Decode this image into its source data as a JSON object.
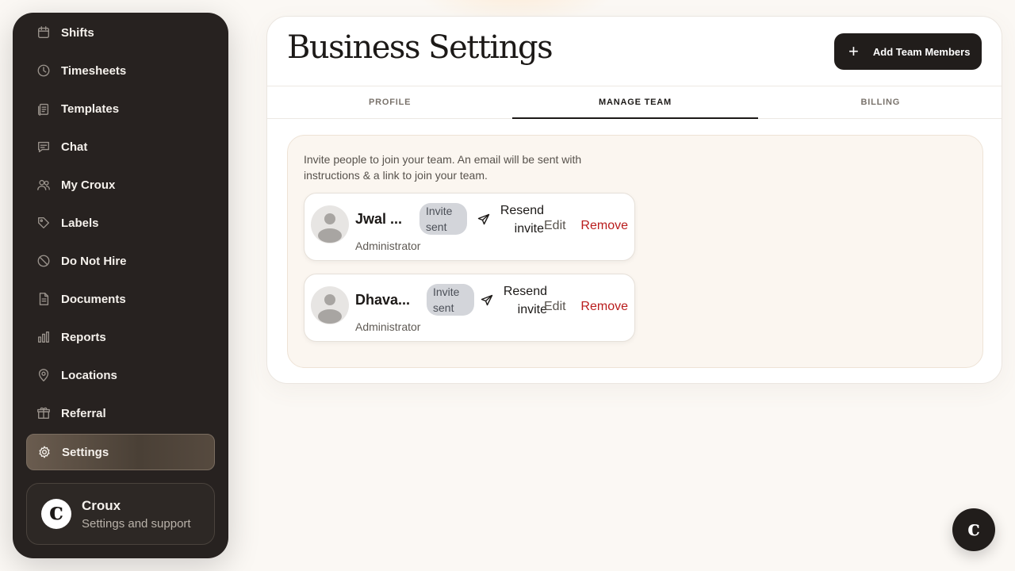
{
  "sidebar": {
    "items": [
      {
        "label": "Shifts",
        "icon": "calendar-icon"
      },
      {
        "label": "Timesheets",
        "icon": "clock-icon"
      },
      {
        "label": "Templates",
        "icon": "clipboard-icon"
      },
      {
        "label": "Chat",
        "icon": "chat-icon"
      },
      {
        "label": "My Croux",
        "icon": "users-icon"
      },
      {
        "label": "Labels",
        "icon": "tag-icon"
      },
      {
        "label": "Do Not Hire",
        "icon": "ban-icon"
      },
      {
        "label": "Documents",
        "icon": "document-icon"
      },
      {
        "label": "Reports",
        "icon": "bar-chart-icon"
      },
      {
        "label": "Locations",
        "icon": "map-pin-icon"
      },
      {
        "label": "Referral",
        "icon": "gift-icon"
      },
      {
        "label": "Settings",
        "icon": "gear-icon",
        "active": true
      }
    ],
    "account": {
      "name": "Croux",
      "subtitle": "Settings and support",
      "logo_letter": "c"
    }
  },
  "header": {
    "title": "Business Settings",
    "add_button_label": "Add Team Members"
  },
  "tabs": [
    {
      "label": "PROFILE"
    },
    {
      "label": "MANAGE TEAM",
      "active": true
    },
    {
      "label": "BILLING"
    }
  ],
  "team": {
    "intro": "Invite people to join your team. An email will be sent with instructions & a link to join your team.",
    "members": [
      {
        "name": "Jwal ...",
        "role": "Administrator",
        "status": "Invite sent",
        "resend_label": "Resend invite",
        "edit_label": "Edit",
        "remove_label": "Remove"
      },
      {
        "name": "Dhava...",
        "role": "Administrator",
        "status": "Invite sent",
        "resend_label": "Resend invite",
        "edit_label": "Edit",
        "remove_label": "Remove"
      }
    ]
  },
  "chat_fab": {
    "letter": "c"
  },
  "colors": {
    "sidebar_bg": "#272220",
    "page_bg": "#fbf8f4",
    "remove_red": "#b91c1c",
    "badge_bg": "#d3d5da",
    "primary_dark": "#211d1b"
  }
}
